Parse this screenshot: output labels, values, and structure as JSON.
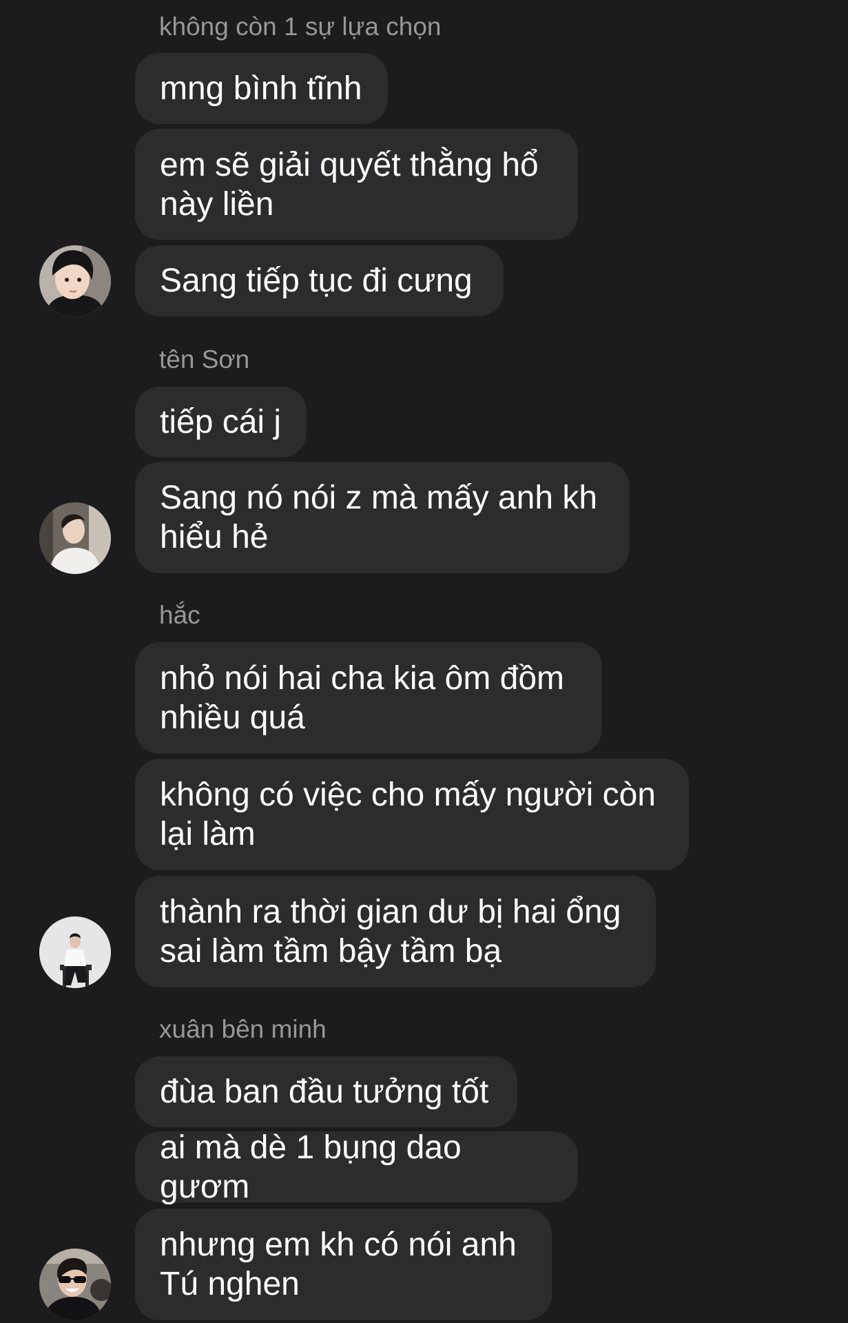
{
  "groups": [
    {
      "sender_name": "không còn 1 sự lựa chọn",
      "avatar_icon": "user-avatar-photo",
      "messages": [
        "mng bình tĩnh",
        "em sẽ giải quyết thằng hổ\nnày liền",
        "Sang tiếp tục đi cưng"
      ]
    },
    {
      "sender_name": "tên Sơn",
      "avatar_icon": "user-avatar-photo",
      "messages": [
        "tiếp cái j",
        "Sang nó nói z mà mấy anh kh\nhiểu hẻ"
      ]
    },
    {
      "sender_name": "hắc",
      "avatar_icon": "user-avatar-photo",
      "messages": [
        "nhỏ nói hai cha kia ôm đồm\nnhiều quá",
        "không có việc cho mấy người còn\nlại làm",
        "thành ra thời gian dư bị hai ổng\nsai làm tầm bậy tầm bạ"
      ]
    },
    {
      "sender_name": "xuân bên minh",
      "avatar_icon": "user-avatar-photo",
      "messages": [
        "đùa ban đầu tưởng tốt",
        "ai mà dè 1 bụng dao gươm",
        "nhưng em kh có nói anh\nTú nghen"
      ]
    }
  ],
  "colors": {
    "background": "#1c1c1e",
    "bubble": "#2c2c2e",
    "sender_name": "#97979c",
    "text": "#ffffff"
  }
}
